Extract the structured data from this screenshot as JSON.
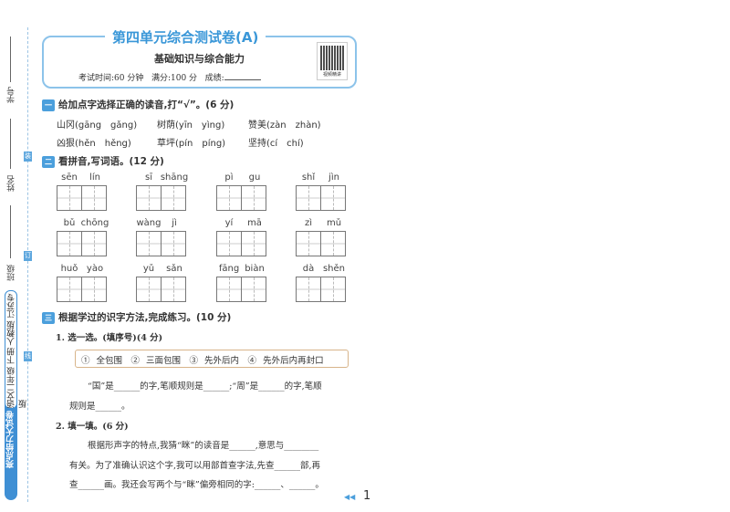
{
  "spine": {
    "student_no_label": "学号",
    "name_label": "姓名",
    "class_label": "班级",
    "binding_marks": [
      "装",
      "订",
      "线"
    ],
    "brand": "亮点给力大试卷",
    "book_info": "语文二年级 下册 人教版 江苏专版"
  },
  "header": {
    "title": "第四单元综合测试卷(A)",
    "subtitle": "基础知识与综合能力",
    "exam_time": "考试时间:60 分钟",
    "full_score": "满分:100 分",
    "score_label": "成绩:",
    "qr_caption": "视频精讲"
  },
  "section1": {
    "num": "一",
    "title": "给加点字选择正确的读音,打“√”。(6 分)",
    "items": [
      "山冈(gāng　gǎng)",
      "树荫(yīn　yìng)",
      "赞美(zàn　zhàn)",
      "凶狠(hěn　hěng)",
      "草坪(pín　píng)",
      "坚持(cí　chí)"
    ]
  },
  "section2": {
    "num": "二",
    "title": "看拼音,写词语。(12 分)",
    "words": [
      [
        "sēn",
        "lín"
      ],
      [
        "sī",
        "shāng"
      ],
      [
        "pì",
        "gu"
      ],
      [
        "shǐ",
        "jìn"
      ],
      [
        "bǔ",
        "chōng"
      ],
      [
        "wàng",
        "jì"
      ],
      [
        "yí",
        "mā"
      ],
      [
        "zì",
        "mǔ"
      ],
      [
        "huǒ",
        "yào"
      ],
      [
        "yǔ",
        "sǎn"
      ],
      [
        "fāng",
        "biàn"
      ],
      [
        "dà",
        "shěn"
      ]
    ]
  },
  "section3": {
    "num": "三",
    "title": "根据学过的识字方法,完成练习。(10 分)",
    "q1_title": "1. 选一选。(填序号)(4 分)",
    "q1_options": "① 全包围　② 三面包围　③ 先外后内　④ 先外后内再封口",
    "q1_line1": "“国”是______的字,笔顺规则是______;“周”是______的字,笔顺",
    "q1_line2": "规则是______。",
    "q2_title": "2. 填一填。(6 分)",
    "q2_line1": "根据形声字的特点,我猜“眯”的读音是______,意思与________",
    "q2_line2": "有关。为了准确认识这个字,我可以用部首查字法,先查______部,再",
    "q2_line3": "查______画。我还会写两个与“眯”偏旁相同的字:______、______。"
  },
  "footer": {
    "page_number": "1"
  }
}
